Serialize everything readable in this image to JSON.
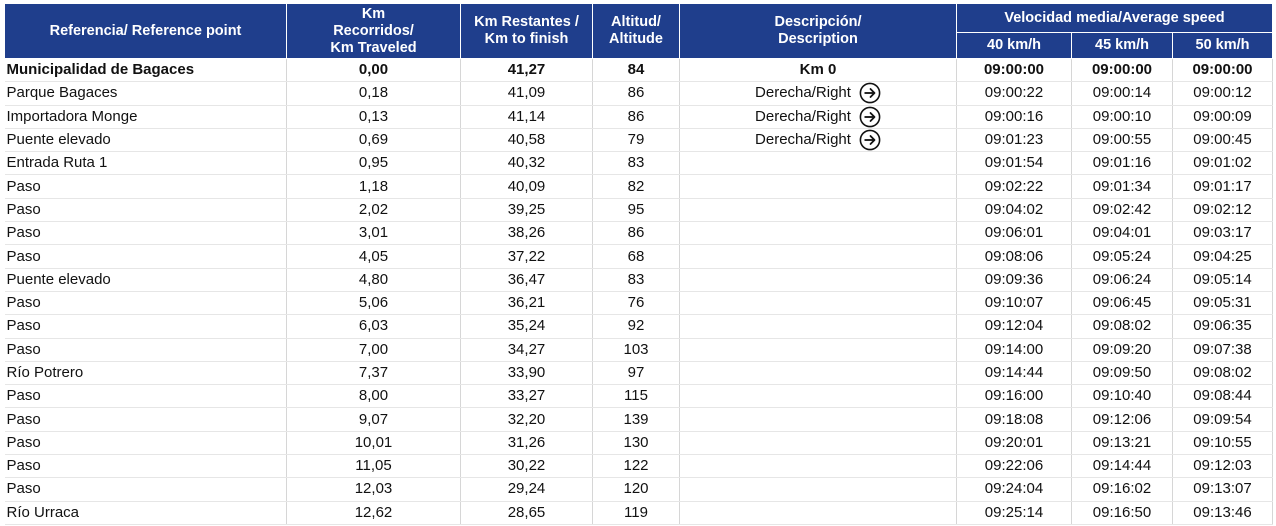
{
  "headers": {
    "reference": "Referencia/ Reference point",
    "km_traveled": [
      "Km",
      "Recorridos/",
      "Km Traveled"
    ],
    "km_remaining": [
      "Km Restantes /",
      "Km to finish"
    ],
    "altitude": [
      "Altitud/",
      "Altitude"
    ],
    "description": [
      "Descripción/",
      "Description"
    ],
    "speed_group": "Velocidad media/Average speed",
    "speeds": [
      "40 km/h",
      "45 km/h",
      "50 km/h"
    ]
  },
  "icons": {
    "turn": "arrow-right-circle-icon"
  },
  "rows": [
    {
      "ref": "Municipalidad de Bagaces",
      "km": "0,00",
      "rem": "41,27",
      "alt": "84",
      "desc": "Km 0",
      "arrow": false,
      "t40": "09:00:00",
      "t45": "09:00:00",
      "t50": "09:00:00",
      "bold": true
    },
    {
      "ref": "Parque Bagaces",
      "km": "0,18",
      "rem": "41,09",
      "alt": "86",
      "desc": "Derecha/Right",
      "arrow": true,
      "t40": "09:00:22",
      "t45": "09:00:14",
      "t50": "09:00:12"
    },
    {
      "ref": "Importadora Monge",
      "km": "0,13",
      "rem": "41,14",
      "alt": "86",
      "desc": "Derecha/Right",
      "arrow": true,
      "t40": "09:00:16",
      "t45": "09:00:10",
      "t50": "09:00:09"
    },
    {
      "ref": "Puente elevado",
      "km": "0,69",
      "rem": "40,58",
      "alt": "79",
      "desc": "Derecha/Right",
      "arrow": true,
      "t40": "09:01:23",
      "t45": "09:00:55",
      "t50": "09:00:45"
    },
    {
      "ref": "Entrada Ruta 1",
      "km": "0,95",
      "rem": "40,32",
      "alt": "83",
      "desc": "",
      "arrow": false,
      "t40": "09:01:54",
      "t45": "09:01:16",
      "t50": "09:01:02"
    },
    {
      "ref": "Paso",
      "km": "1,18",
      "rem": "40,09",
      "alt": "82",
      "desc": "",
      "arrow": false,
      "t40": "09:02:22",
      "t45": "09:01:34",
      "t50": "09:01:17"
    },
    {
      "ref": "Paso",
      "km": "2,02",
      "rem": "39,25",
      "alt": "95",
      "desc": "",
      "arrow": false,
      "t40": "09:04:02",
      "t45": "09:02:42",
      "t50": "09:02:12"
    },
    {
      "ref": "Paso",
      "km": "3,01",
      "rem": "38,26",
      "alt": "86",
      "desc": "",
      "arrow": false,
      "t40": "09:06:01",
      "t45": "09:04:01",
      "t50": "09:03:17"
    },
    {
      "ref": "Paso",
      "km": "4,05",
      "rem": "37,22",
      "alt": "68",
      "desc": "",
      "arrow": false,
      "t40": "09:08:06",
      "t45": "09:05:24",
      "t50": "09:04:25"
    },
    {
      "ref": "Puente elevado",
      "km": "4,80",
      "rem": "36,47",
      "alt": "83",
      "desc": "",
      "arrow": false,
      "t40": "09:09:36",
      "t45": "09:06:24",
      "t50": "09:05:14"
    },
    {
      "ref": "Paso",
      "km": "5,06",
      "rem": "36,21",
      "alt": "76",
      "desc": "",
      "arrow": false,
      "t40": "09:10:07",
      "t45": "09:06:45",
      "t50": "09:05:31"
    },
    {
      "ref": "Paso",
      "km": "6,03",
      "rem": "35,24",
      "alt": "92",
      "desc": "",
      "arrow": false,
      "t40": "09:12:04",
      "t45": "09:08:02",
      "t50": "09:06:35"
    },
    {
      "ref": "Paso",
      "km": "7,00",
      "rem": "34,27",
      "alt": "103",
      "desc": "",
      "arrow": false,
      "t40": "09:14:00",
      "t45": "09:09:20",
      "t50": "09:07:38"
    },
    {
      "ref": "Río Potrero",
      "km": "7,37",
      "rem": "33,90",
      "alt": "97",
      "desc": "",
      "arrow": false,
      "t40": "09:14:44",
      "t45": "09:09:50",
      "t50": "09:08:02"
    },
    {
      "ref": "Paso",
      "km": "8,00",
      "rem": "33,27",
      "alt": "115",
      "desc": "",
      "arrow": false,
      "t40": "09:16:00",
      "t45": "09:10:40",
      "t50": "09:08:44"
    },
    {
      "ref": "Paso",
      "km": "9,07",
      "rem": "32,20",
      "alt": "139",
      "desc": "",
      "arrow": false,
      "t40": "09:18:08",
      "t45": "09:12:06",
      "t50": "09:09:54"
    },
    {
      "ref": "Paso",
      "km": "10,01",
      "rem": "31,26",
      "alt": "130",
      "desc": "",
      "arrow": false,
      "t40": "09:20:01",
      "t45": "09:13:21",
      "t50": "09:10:55"
    },
    {
      "ref": "Paso",
      "km": "11,05",
      "rem": "30,22",
      "alt": "122",
      "desc": "",
      "arrow": false,
      "t40": "09:22:06",
      "t45": "09:14:44",
      "t50": "09:12:03"
    },
    {
      "ref": "Paso",
      "km": "12,03",
      "rem": "29,24",
      "alt": "120",
      "desc": "",
      "arrow": false,
      "t40": "09:24:04",
      "t45": "09:16:02",
      "t50": "09:13:07"
    },
    {
      "ref": "Río Urraca",
      "km": "12,62",
      "rem": "28,65",
      "alt": "119",
      "desc": "",
      "arrow": false,
      "t40": "09:25:14",
      "t45": "09:16:50",
      "t50": "09:13:46"
    }
  ]
}
